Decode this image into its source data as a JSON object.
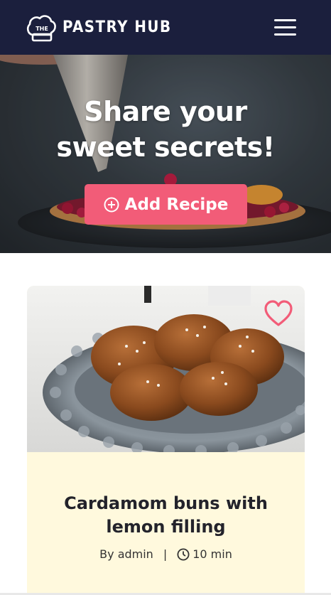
{
  "header": {
    "brand_badge": "THE",
    "brand_name": "PASTRY HUB",
    "menu_icon": "hamburger-menu-icon"
  },
  "hero": {
    "title_line1": "Share your",
    "title_line2": "sweet secrets!",
    "add_button_label": "Add Recipe",
    "add_icon": "plus-circle-icon"
  },
  "recipe": {
    "title": "Cardamom buns with lemon filling",
    "author": "By admin",
    "separator": "|",
    "time": "10 min",
    "favorite_icon": "heart-outline-icon",
    "time_icon": "clock-icon"
  },
  "colors": {
    "header_bg": "#1b1f3d",
    "accent": "#f25c78",
    "card_bg": "#fff9dd",
    "text_dark": "#23232b"
  }
}
